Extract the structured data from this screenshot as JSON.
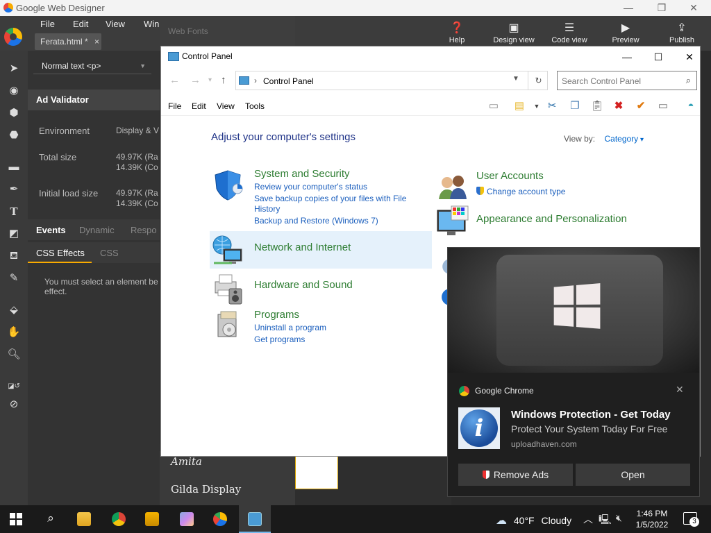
{
  "gwd": {
    "app_title": "Google Web Designer",
    "menu": [
      "File",
      "Edit",
      "View",
      "Win"
    ],
    "file_tab": "Ferata.html *",
    "file_tab_close": "×",
    "tools": [
      "Help",
      "Design view",
      "Code view",
      "Preview",
      "Publish"
    ],
    "web_fonts": "Web Fonts",
    "text_style": "Normal text <p>",
    "panel_title": "Ad Validator",
    "rows": [
      {
        "label": "Environment",
        "value": "Display & V"
      },
      {
        "label": "Total size",
        "value": "49.97K (Ra",
        "value2": "14.39K (Co"
      },
      {
        "label": "Initial load size",
        "value": "49.97K (Ra",
        "value2": "14.39K (Co"
      }
    ],
    "event_tabs": [
      "Events",
      "Dynamic",
      "Respo"
    ],
    "css_tabs": [
      "CSS Effects",
      "CSS"
    ],
    "css_message": "You must select an element be effect.",
    "fonts": [
      "Amita",
      "Gilda Display"
    ]
  },
  "control_panel": {
    "title": "Control Panel",
    "address": "Control Panel",
    "search_placeholder": "Search Control Panel",
    "menu": [
      "File",
      "Edit",
      "View",
      "Tools"
    ],
    "heading": "Adjust your computer's settings",
    "view_by_label": "View by:",
    "view_by_value": "Category",
    "categories": [
      {
        "title": "System and Security",
        "links": [
          "Review your computer's status",
          "Save backup copies of your files with File",
          "History",
          "Backup and Restore (Windows 7)"
        ]
      },
      {
        "title": "Network and Internet",
        "links": []
      },
      {
        "title": "Hardware and Sound",
        "links": []
      },
      {
        "title": "Programs",
        "links": [
          "Uninstall a program",
          "Get programs"
        ]
      },
      {
        "title": "User Accounts",
        "links": [
          "Change account type"
        ]
      },
      {
        "title": "Appearance and Personalization",
        "links": []
      }
    ]
  },
  "notification": {
    "source": "Google Chrome",
    "title": "Windows Protection - Get Today",
    "body": "Protect Your System Today For Free",
    "url": "uploadhaven.com",
    "buttons": [
      "Remove Ads",
      "Open"
    ]
  },
  "taskbar": {
    "weather_temp": "40°F",
    "weather_desc": "Cloudy",
    "time": "1:46 PM",
    "date": "1/5/2022",
    "notification_count": "3"
  },
  "colors": {
    "accent": "#f9ab00",
    "cp_heading": "#1e3287",
    "cp_category": "#2e7d32",
    "cp_link": "#1a5ebd"
  }
}
